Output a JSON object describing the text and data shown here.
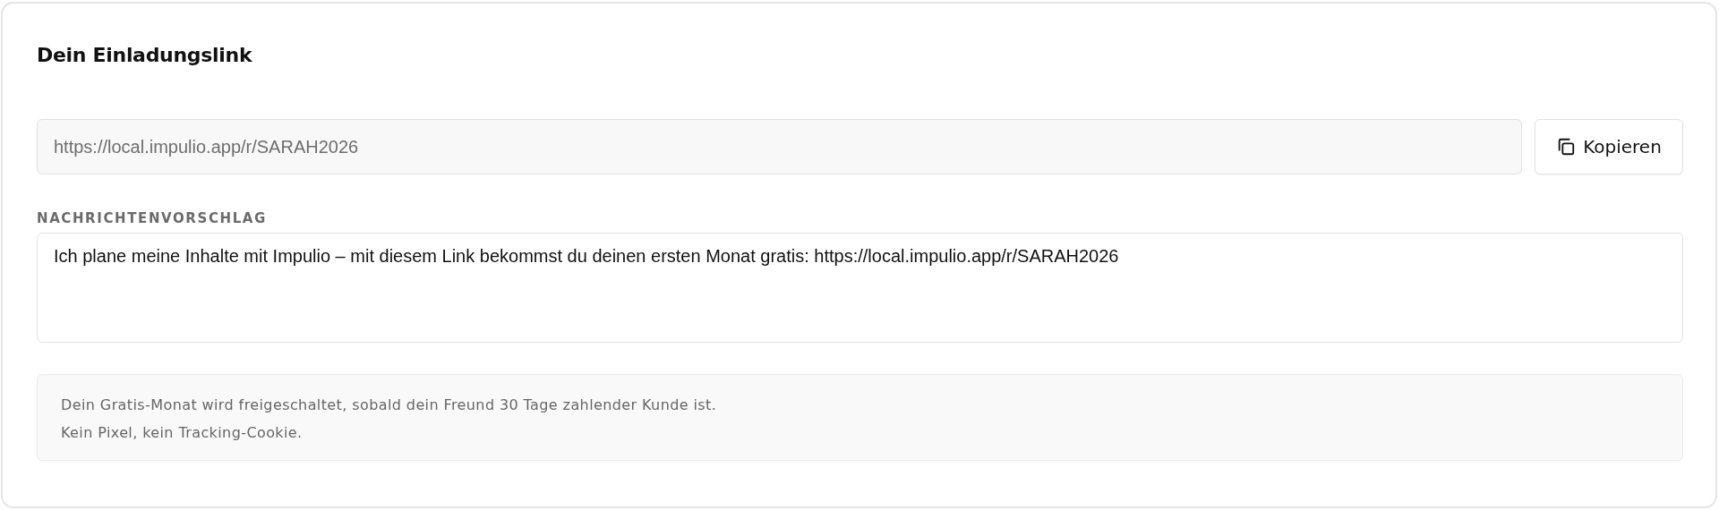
{
  "card": {
    "title": "Dein Einladungslink"
  },
  "link_field": {
    "value": "https://local.impulio.app/r/SARAH2026"
  },
  "copy_button": {
    "label": "Kopieren"
  },
  "message": {
    "label": "NACHRICHTENVORSCHLAG",
    "value": "Ich plane meine Inhalte mit Impulio – mit diesem Link bekommst du deinen ersten Monat gratis: https://local.impulio.app/r/SARAH2026"
  },
  "info": {
    "lines": [
      "Dein Gratis-Monat wird freigeschaltet, sobald dein Freund 30 Tage zahlender Kunde ist.",
      "Kein Pixel, kein Tracking-Cookie."
    ]
  }
}
